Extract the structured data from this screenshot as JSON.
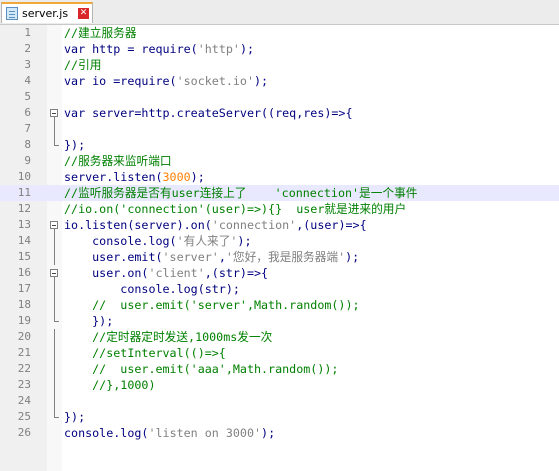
{
  "tab": {
    "label": "server.js",
    "close": "✕"
  },
  "lines": [
    {
      "n": "1",
      "text": "//建立服务器",
      "fold": ""
    },
    {
      "n": "2",
      "text": "var http = require('http');",
      "fold": ""
    },
    {
      "n": "3",
      "text": "//引用",
      "fold": ""
    },
    {
      "n": "4",
      "text": "var io =require('socket.io');",
      "fold": ""
    },
    {
      "n": "5",
      "text": "",
      "fold": ""
    },
    {
      "n": "6",
      "text": "var server=http.createServer((req,res)=>{",
      "fold": "start"
    },
    {
      "n": "7",
      "text": "",
      "fold": "mid"
    },
    {
      "n": "8",
      "text": "});",
      "fold": "end"
    },
    {
      "n": "9",
      "text": "//服务器来监听端口",
      "fold": ""
    },
    {
      "n": "10",
      "text": "server.listen(3000);",
      "fold": ""
    },
    {
      "n": "11",
      "text": "//监听服务器是否有user连接上了    'connection'是一个事件",
      "fold": "",
      "hl": true
    },
    {
      "n": "12",
      "text": "//io.on('connection'(user)=>){}  user就是进来的用户",
      "fold": ""
    },
    {
      "n": "13",
      "text": "io.listen(server).on('connection',(user)=>{",
      "fold": "start"
    },
    {
      "n": "14",
      "text": "    console.log('有人来了');",
      "fold": "mid"
    },
    {
      "n": "15",
      "text": "    user.emit('server','您好，我是服务器端');",
      "fold": "mid"
    },
    {
      "n": "16",
      "text": "    user.on('client',(str)=>{",
      "fold": "start"
    },
    {
      "n": "17",
      "text": "        console.log(str);",
      "fold": "mid"
    },
    {
      "n": "18",
      "text": "    //  user.emit('server',Math.random());",
      "fold": "mid"
    },
    {
      "n": "19",
      "text": "    });",
      "fold": "end"
    },
    {
      "n": "20",
      "text": "    //定时器定时发送,1000ms发一次",
      "fold": "mid"
    },
    {
      "n": "21",
      "text": "    //setInterval(()=>{",
      "fold": "mid"
    },
    {
      "n": "22",
      "text": "    //  user.emit('aaa',Math.random());",
      "fold": "mid"
    },
    {
      "n": "23",
      "text": "    //},1000)",
      "fold": "mid"
    },
    {
      "n": "24",
      "text": "",
      "fold": "mid"
    },
    {
      "n": "25",
      "text": "});",
      "fold": "end"
    },
    {
      "n": "26",
      "text": "console.log('listen on 3000');",
      "fold": ""
    }
  ]
}
